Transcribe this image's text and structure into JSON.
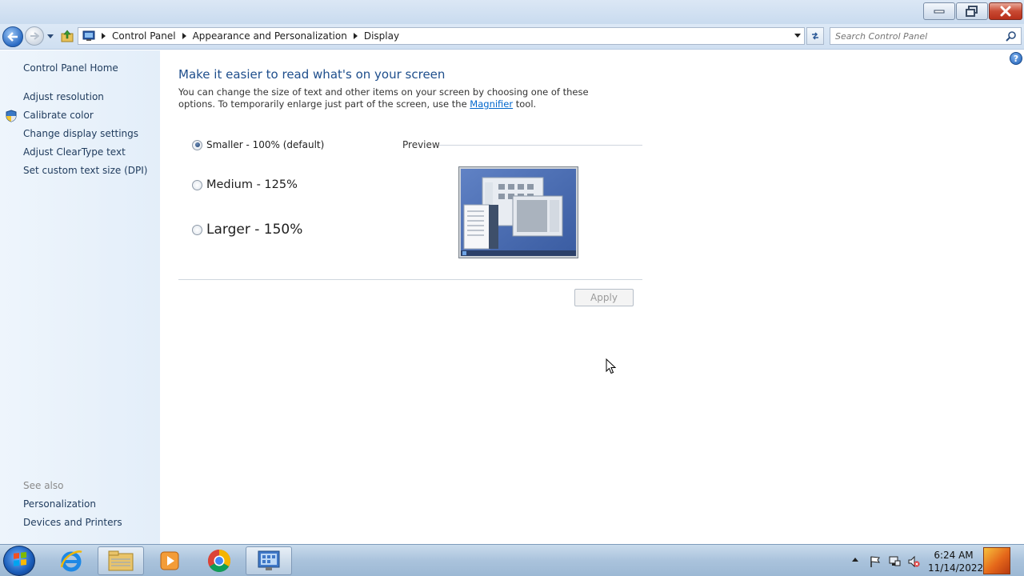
{
  "window": {
    "controls": {
      "minimize": "minimize",
      "maximize": "maximize",
      "close": "close"
    }
  },
  "nav": {
    "breadcrumbs": [
      "Control Panel",
      "Appearance and Personalization",
      "Display"
    ],
    "search_placeholder": "Search Control Panel"
  },
  "sidebar": {
    "home": "Control Panel Home",
    "links": [
      "Adjust resolution",
      "Calibrate color",
      "Change display settings",
      "Adjust ClearType text",
      "Set custom text size (DPI)"
    ],
    "see_also_label": "See also",
    "see_also": [
      "Personalization",
      "Devices and Printers"
    ]
  },
  "main": {
    "help": "?",
    "title": "Make it easier to read what's on your screen",
    "description_part1": "You can change the size of text and other items on your screen by choosing one of these options. To temporarily enlarge just part of the screen, use the ",
    "magnifier_link": "Magnifier",
    "description_part2": " tool.",
    "options": [
      {
        "label": "Smaller - 100% (default)",
        "selected": true
      },
      {
        "label": "Medium - 125%",
        "selected": false
      },
      {
        "label": "Larger - 150%",
        "selected": false
      }
    ],
    "preview_label": "Preview",
    "apply_label": "Apply"
  },
  "taskbar": {
    "clock_time": "6:24 AM",
    "clock_date": "11/14/2022",
    "pinned": [
      "internet-explorer",
      "windows-explorer",
      "media-player",
      "chrome",
      "control-panel"
    ],
    "active": "control-panel"
  },
  "colors": {
    "title_blue": "#1e4e8c",
    "link_blue": "#0066cc",
    "sidebar_bg": "#e9f2fb"
  }
}
